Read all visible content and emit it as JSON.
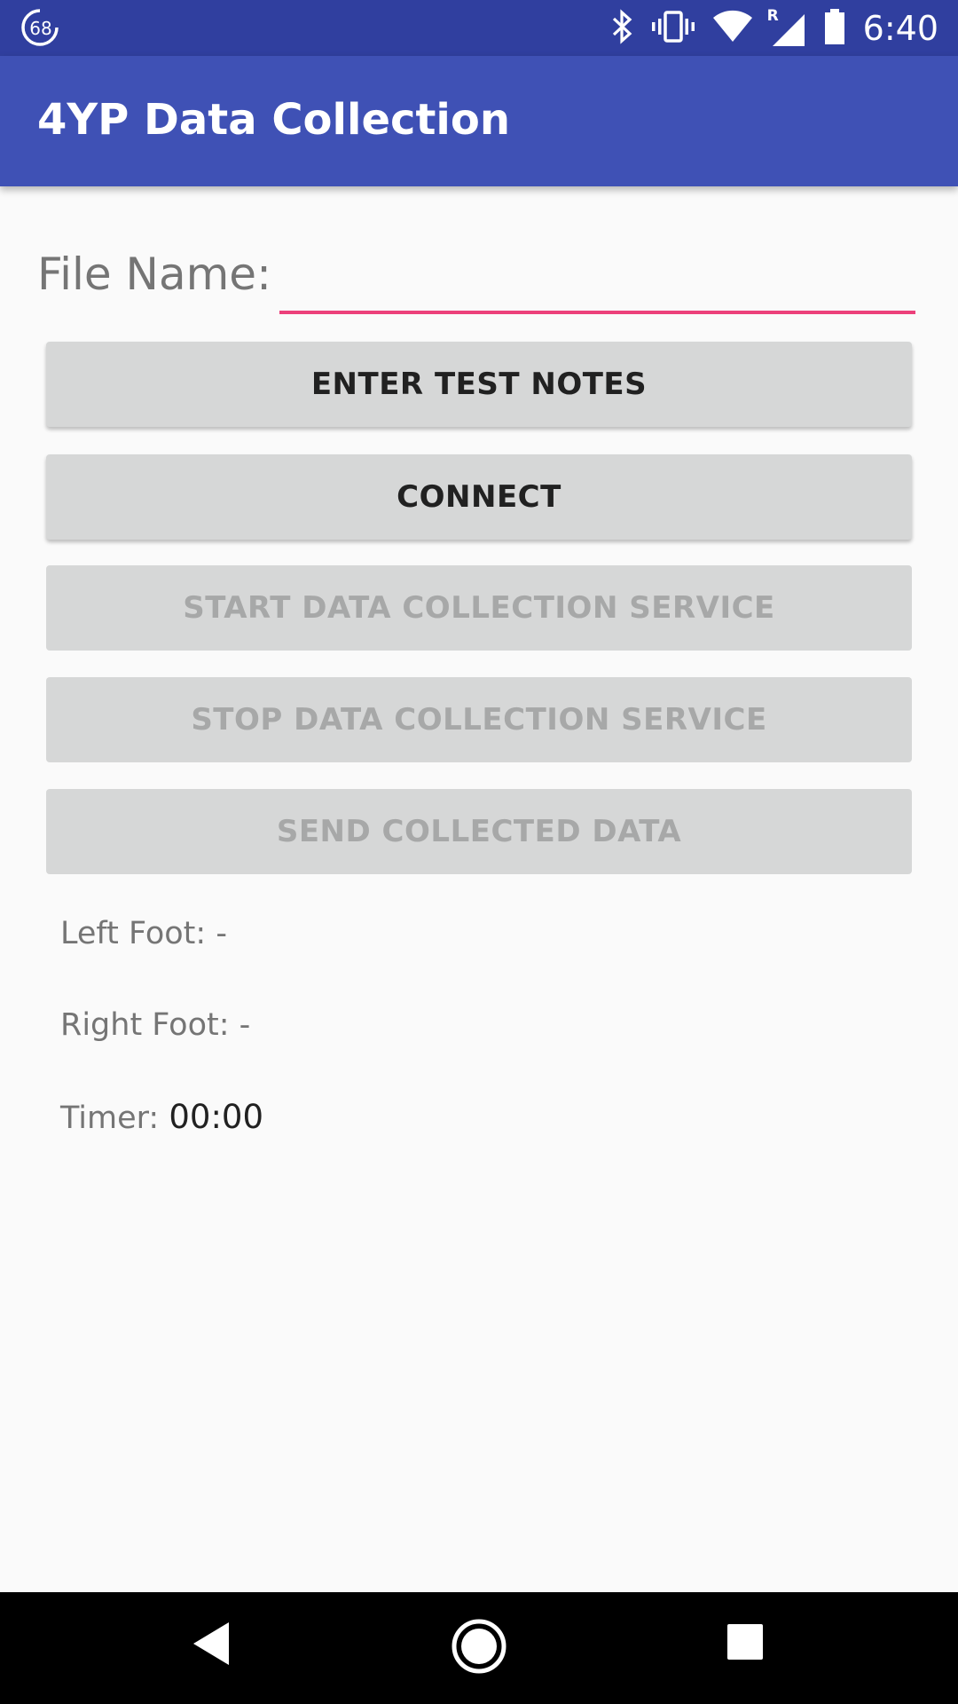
{
  "status_bar": {
    "notification_badge": "68",
    "time": "6:40",
    "network_label": "R",
    "icons": [
      "notification-68-icon",
      "bluetooth-icon",
      "vibrate-icon",
      "wifi-icon",
      "signal-icon",
      "battery-icon"
    ]
  },
  "app_bar": {
    "title": "4YP Data Collection",
    "color": "#3f51b5",
    "status_color": "#303f9f"
  },
  "form": {
    "file_name_label": "File Name:",
    "file_name_value": "",
    "accent_color": "#ec407a"
  },
  "buttons": {
    "enter_test_notes": "ENTER TEST NOTES",
    "connect": "CONNECT",
    "start_service": "START DATA COLLECTION SERVICE",
    "stop_service": "STOP DATA COLLECTION SERVICE",
    "send_data": "SEND COLLECTED DATA"
  },
  "readouts": {
    "left_foot_label": "Left Foot:",
    "left_foot_value": "-",
    "right_foot_label": "Right Foot:",
    "right_foot_value": "-",
    "timer_label": "Timer:",
    "timer_value": "00:00"
  },
  "nav_bar": {
    "icons": [
      "back-icon",
      "home-icon",
      "recents-icon"
    ]
  }
}
